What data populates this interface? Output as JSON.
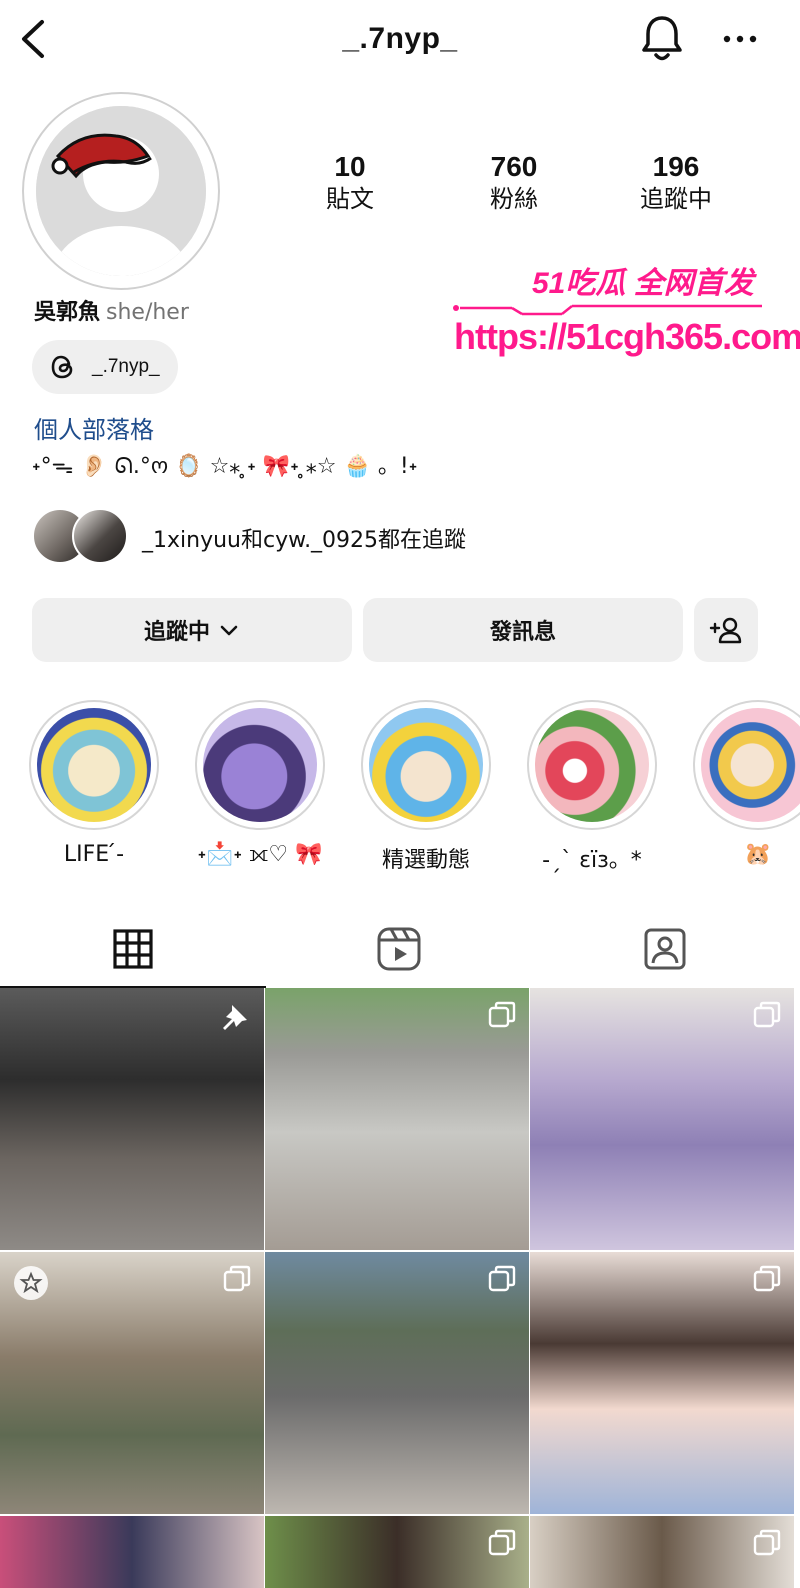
{
  "header": {
    "username": "_.7nyp_"
  },
  "profile": {
    "stats": [
      {
        "count": "10",
        "label": "貼文"
      },
      {
        "count": "760",
        "label": "粉絲"
      },
      {
        "count": "196",
        "label": "追蹤中"
      }
    ],
    "display_name": "吳郭魚",
    "pronouns": "she/her",
    "threads_handle": "_.7nyp_",
    "blog_link": "個人部落格",
    "bio": "˖°ᯓ 👂🏻 ᘏ.°ო 🪞 ☆⁎ ̥˖ 🎀˖ ̥⁎☆ 🧁 。!˖"
  },
  "watermark": {
    "brand": "51吃瓜 全网首发",
    "url": "https://51cgh365.com"
  },
  "mutual": {
    "text": "_1xinyuu和cyw._0925都在追蹤"
  },
  "actions": {
    "follow_label": "追蹤中",
    "message_label": "發訊息"
  },
  "highlights": [
    {
      "label": "LIFE ́-"
    },
    {
      "label": "˖📩˖ ⟗♡ 🎀"
    },
    {
      "label": "精選動態"
    },
    {
      "label": "-ˏˋ ɛïɜ。*"
    },
    {
      "label": "🐹"
    }
  ],
  "tabs": [
    {
      "name": "posts-grid"
    },
    {
      "name": "reels"
    },
    {
      "name": "tagged"
    }
  ],
  "colors": {
    "watermark": "#ff1a8c",
    "link": "#1f4d8c",
    "button_bg": "#efefef"
  }
}
